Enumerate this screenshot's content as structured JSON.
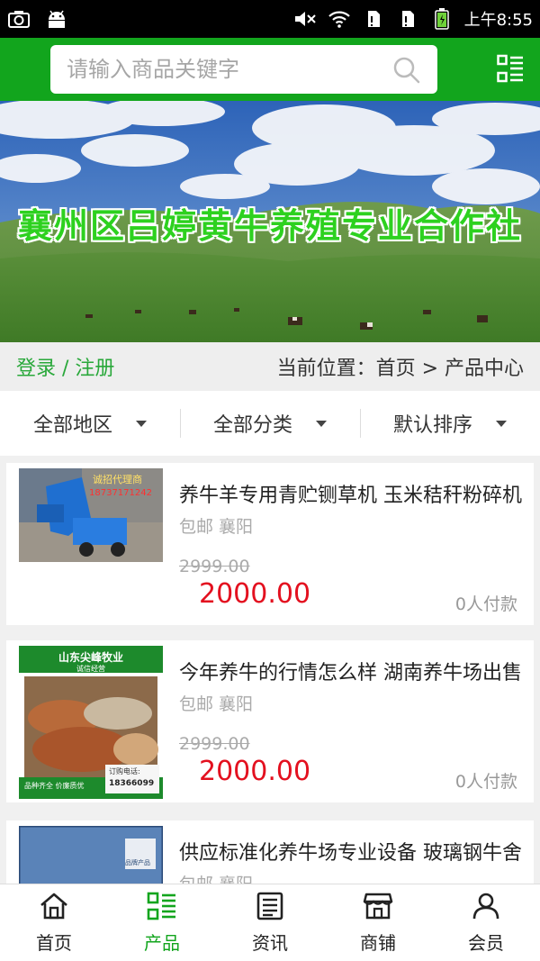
{
  "status": {
    "time": "上午8:55",
    "icons": [
      "camera-icon",
      "android-icon",
      "mute-icon",
      "wifi-icon",
      "sim1-icon",
      "sim2-icon",
      "battery-icon"
    ]
  },
  "search": {
    "placeholder": "请输入商品关键字"
  },
  "banner": {
    "title": "襄州区吕婷黄牛养殖专业合作社"
  },
  "location": {
    "login_label": "登录 / 注册",
    "breadcrumb": "当前位置：首页 > 产品中心"
  },
  "filters": [
    {
      "label": "全部地区"
    },
    {
      "label": "全部分类"
    },
    {
      "label": "默认排序"
    }
  ],
  "products": [
    {
      "title": "养牛羊专用青贮铡草机 玉米秸秆粉碎机",
      "meta": "包邮 襄阳",
      "old_price": "2999.00",
      "price": "2000.00",
      "paid": "0人付款",
      "thumb_text": [
        "诚招代理商",
        "18737171242"
      ]
    },
    {
      "title": "今年养牛的行情怎么样 湖南养牛场出售",
      "meta": "包邮 襄阳",
      "old_price": "2999.00",
      "price": "2000.00",
      "paid": "0人付款",
      "thumb_text": [
        "山东尖峰牧业",
        "诚信经营",
        "品种齐全 价廉质优",
        "订购电话:",
        "18366099"
      ]
    },
    {
      "title": "供应标准化养牛场专业设备 玻璃钢牛舍",
      "meta": "包邮 襄阳",
      "old_price": "",
      "price": "",
      "paid": "",
      "thumb_text": [
        "品牌产品"
      ]
    }
  ],
  "nav": [
    {
      "label": "首页",
      "icon": "home-icon"
    },
    {
      "label": "产品",
      "icon": "products-icon"
    },
    {
      "label": "资讯",
      "icon": "news-icon"
    },
    {
      "label": "商铺",
      "icon": "store-icon"
    },
    {
      "label": "会员",
      "icon": "member-icon"
    }
  ],
  "colors": {
    "brand": "#12a51d",
    "price": "#e3101f",
    "login": "#29a83a"
  }
}
